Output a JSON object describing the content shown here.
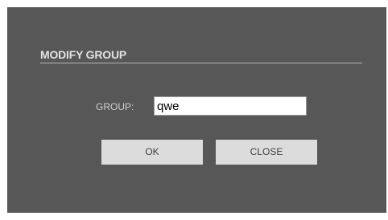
{
  "dialog": {
    "title": "MODIFY GROUP",
    "field_label": "GROUP:",
    "field_value": "qwe",
    "ok_label": "OK",
    "close_label": "CLOSE"
  },
  "colors": {
    "dialog_background": "#575757",
    "title_text": "#e2e2e2",
    "divider": "#b5b5b5",
    "button_background": "#dcdcdc",
    "button_text": "#404040"
  }
}
